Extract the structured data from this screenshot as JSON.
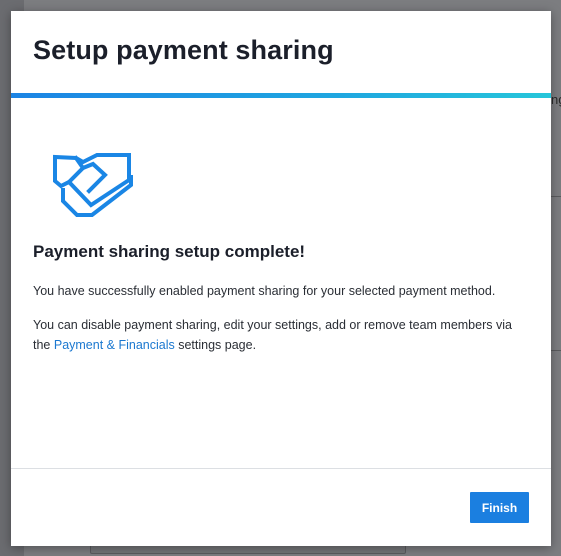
{
  "dialog": {
    "title": "Setup payment sharing",
    "progress_percent": 100,
    "icon": "handshake-icon",
    "heading": "Payment sharing setup complete!",
    "paragraph1": "You have successfully enabled payment sharing for your selected payment method.",
    "paragraph2_before": "You can disable payment sharing, edit your settings, add or remove team members via the ",
    "paragraph2_link": "Payment & Financials",
    "paragraph2_after": " settings page.",
    "finish_label": "Finish"
  },
  "background": {
    "edge_text": "ng"
  },
  "colors": {
    "accent": "#1b7fe0",
    "link": "#1b78d0",
    "icon": "#1a86e5",
    "title": "#1b1f2a",
    "overlay": "#6b6c70"
  }
}
